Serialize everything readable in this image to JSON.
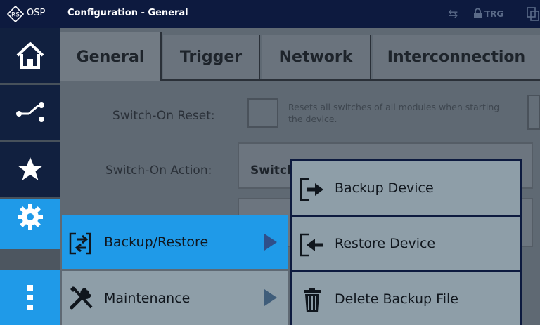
{
  "titlebar": {
    "brand": "OSP",
    "title": "Configuration - General",
    "status_label": "TRG"
  },
  "sidebar": {
    "items": [
      {
        "icon": "home-icon"
      },
      {
        "icon": "route-icon"
      },
      {
        "icon": "star-icon"
      },
      {
        "icon": "gear-icon",
        "active": true
      },
      {
        "icon": "more-vertical-icon"
      }
    ]
  },
  "tabs": [
    {
      "label": "General",
      "active": true
    },
    {
      "label": "Trigger"
    },
    {
      "label": "Network"
    },
    {
      "label": "Interconnection"
    }
  ],
  "settings": {
    "switch_on_reset": {
      "label": "Switch-On Reset:",
      "description": "Resets all switches of all modules when starting the device."
    },
    "switch_on_action": {
      "label": "Switch-On Action:",
      "value": "Switcl"
    }
  },
  "menu": {
    "items": [
      {
        "label": "Backup/Restore",
        "icon": "backup-restore-icon",
        "highlighted": true
      },
      {
        "label": "Maintenance",
        "icon": "tools-icon"
      }
    ]
  },
  "submenu": {
    "items": [
      {
        "label": "Backup Device",
        "icon": "backup-device-icon"
      },
      {
        "label": "Restore Device",
        "icon": "restore-device-icon"
      },
      {
        "label": "Delete Backup File",
        "icon": "trash-icon"
      }
    ]
  },
  "colors": {
    "titlebar": "#0d1a3f",
    "accent": "#1f9ae8",
    "menu_item": "#8e9ea8"
  }
}
